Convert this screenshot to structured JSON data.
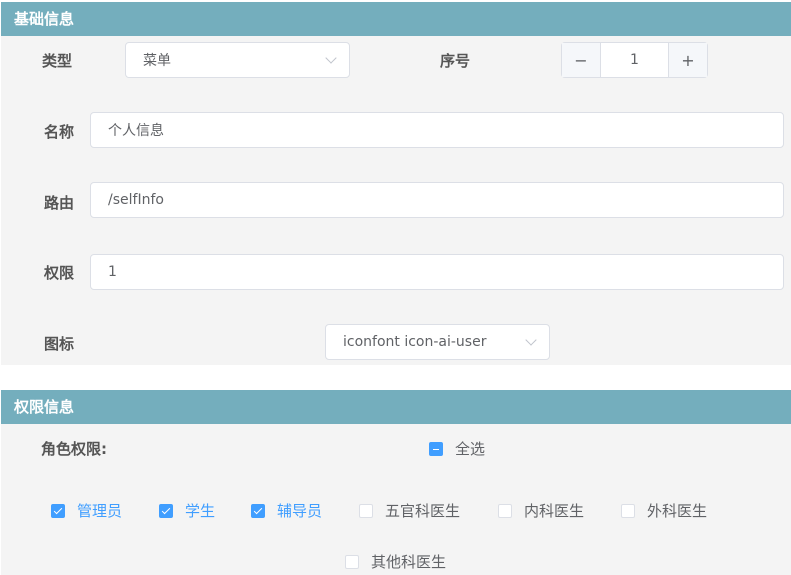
{
  "basic": {
    "title": "基础信息",
    "type_label": "类型",
    "type_value": "菜单",
    "order_label": "序号",
    "order_value": "1",
    "minus": "−",
    "plus": "+",
    "name_label": "名称",
    "name_value": "个人信息",
    "route_label": "路由",
    "route_value": "/selfInfo",
    "perm_label": "权限",
    "perm_value": "1",
    "icon_label": "图标",
    "icon_value": "iconfont icon-ai-user"
  },
  "permissions": {
    "title": "权限信息",
    "role_label": "角色权限:",
    "select_all": "全选",
    "roles": [
      {
        "label": "管理员",
        "checked": true
      },
      {
        "label": "学生",
        "checked": true
      },
      {
        "label": "辅导员",
        "checked": true
      },
      {
        "label": "五官科医生",
        "checked": false
      },
      {
        "label": "内科医生",
        "checked": false
      },
      {
        "label": "外科医生",
        "checked": false
      },
      {
        "label": "其他科医生",
        "checked": false
      }
    ]
  },
  "colors": {
    "header": "#74aebd",
    "accent": "#409eff"
  }
}
